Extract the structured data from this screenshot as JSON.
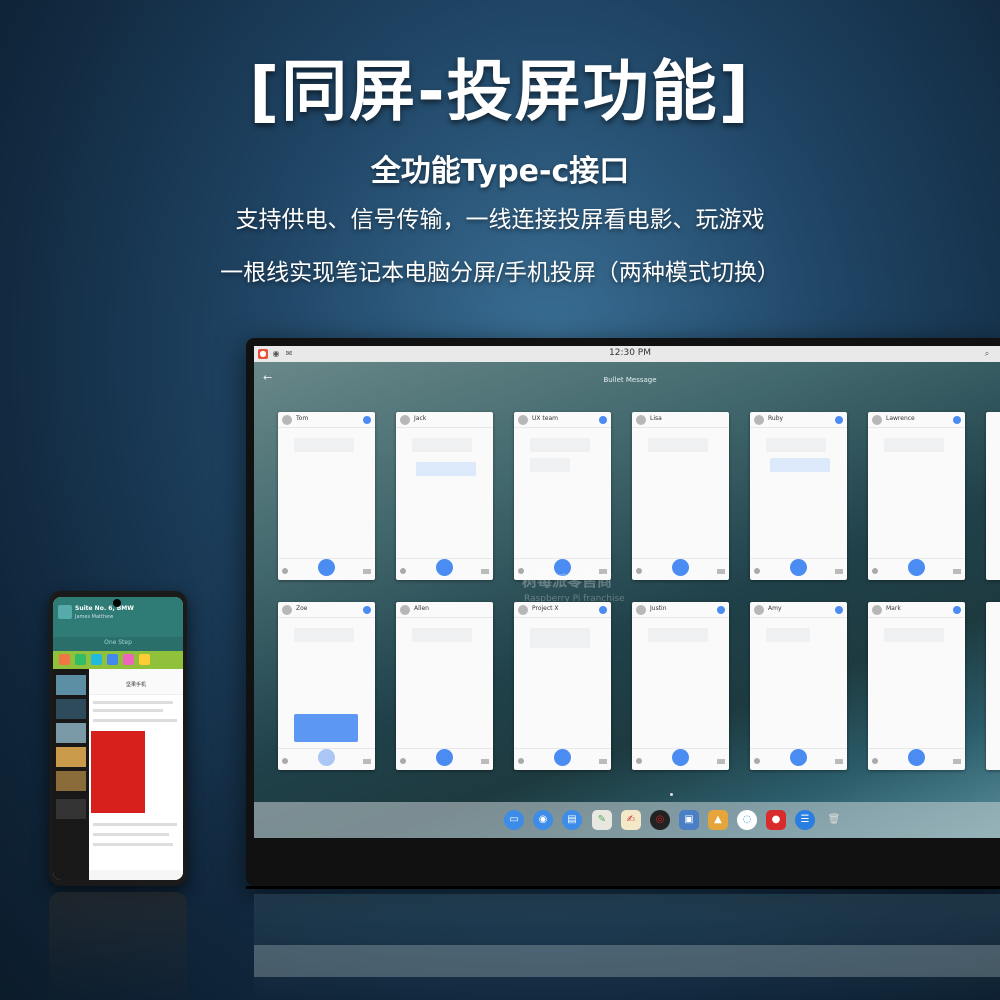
{
  "headline": "[同屏-投屏功能]",
  "subtitle": "全功能Type-c接口",
  "line1": "支持供电、信号传输，一线连接投屏看电影、玩游戏",
  "line2": "一根线实现笔记本电脑分屏/手机投屏（两种模式切换）",
  "monitor": {
    "clock": "12:30 PM",
    "app_title": "Bullet Message",
    "watermark": "树莓派零售商",
    "watermark_sub": "Raspberry Pi franchise",
    "cards_row1": [
      {
        "name": "Tom"
      },
      {
        "name": "Jack"
      },
      {
        "name": "UX team"
      },
      {
        "name": "Lisa"
      },
      {
        "name": "Ruby"
      },
      {
        "name": "Lawrence"
      }
    ],
    "cards_row2": [
      {
        "name": "Zoe"
      },
      {
        "name": "Allen"
      },
      {
        "name": "Project X"
      },
      {
        "name": "Justin"
      },
      {
        "name": "Amy"
      },
      {
        "name": "Mark"
      }
    ]
  },
  "phone": {
    "music_title": "Suite No. 6, BMW",
    "music_artist": "James Matthew",
    "one_stop": "One Step",
    "weibo_title": "坚果手机"
  },
  "colors": {
    "accent_blue": "#4a8cf2",
    "poster_red": "#d7201b",
    "music_teal": "#2f7b76",
    "app_strip_green": "#8fc23a"
  }
}
